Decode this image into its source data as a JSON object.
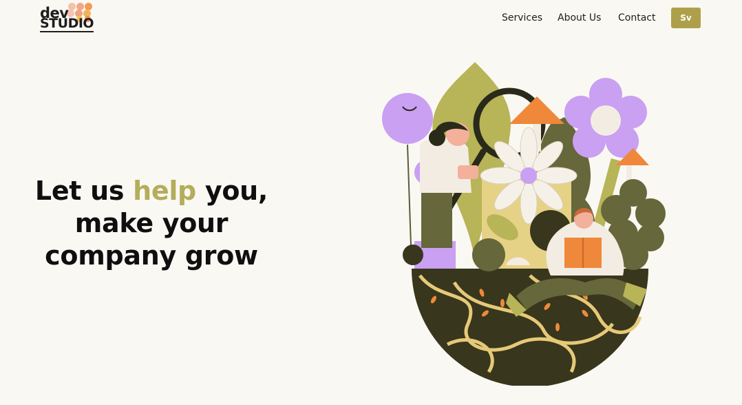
{
  "brand": {
    "top": "dev",
    "bottom": "STUDIO"
  },
  "nav": {
    "items": [
      {
        "label": "Services"
      },
      {
        "label": "About Us"
      },
      {
        "label": "Contact"
      }
    ],
    "lang_button": "Sv"
  },
  "hero": {
    "line1_before": "Let us ",
    "line1_accent": "help",
    "line1_after": " you,",
    "line2": "make your",
    "line3": "company grow"
  },
  "colors": {
    "background": "#faf8f3",
    "accent": "#aea04a",
    "accent_text": "#b4ad5a",
    "text": "#0f0f0f"
  }
}
